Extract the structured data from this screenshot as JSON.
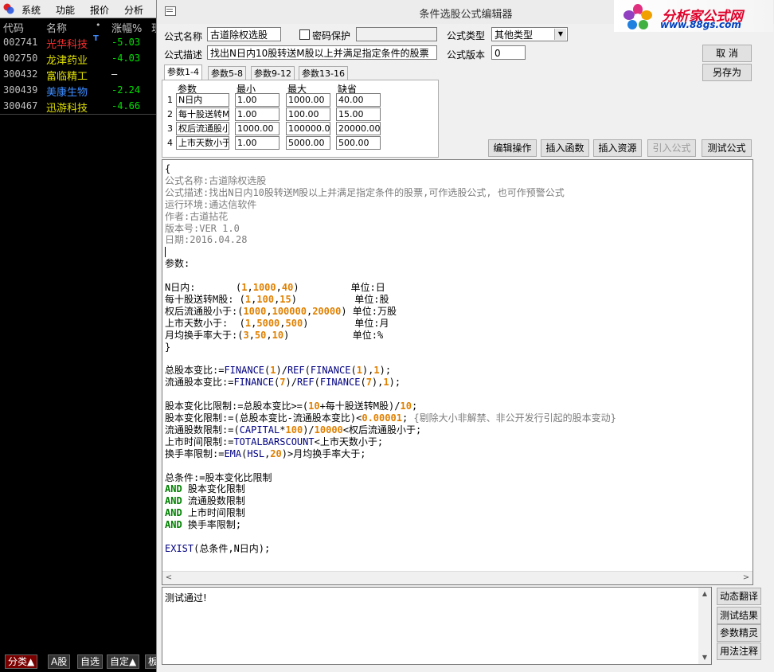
{
  "left_panel": {
    "menu": [
      "系统",
      "功能",
      "报价",
      "分析"
    ],
    "headers": {
      "code": "代码",
      "name": "名称",
      "dot": "•",
      "change": "涨幅%",
      "extra": "现"
    },
    "rows": [
      {
        "code": "002741",
        "name": "光华科技",
        "badge": "T",
        "change": "-5.03",
        "name_color": "#FF3030",
        "change_color": "#00E000"
      },
      {
        "code": "002750",
        "name": "龙津药业",
        "badge": "",
        "change": "-4.03",
        "name_color": "#E0E000",
        "change_color": "#00E000"
      },
      {
        "code": "300432",
        "name": "富临精工",
        "badge": "",
        "change": "—",
        "name_color": "#E0E000",
        "change_color": "#FFFFFF"
      },
      {
        "code": "300439",
        "name": "美康生物",
        "badge": "",
        "change": "-2.24",
        "name_color": "#3C8CFF",
        "change_color": "#00E000"
      },
      {
        "code": "300467",
        "name": "迅游科技",
        "badge": "",
        "change": "-4.66",
        "name_color": "#E0E000",
        "change_color": "#00E000"
      }
    ],
    "bottom_tabs": [
      "分类▲",
      "A股",
      "自选",
      "自定▲",
      "板"
    ]
  },
  "dialog": {
    "title": "条件选股公式编辑器",
    "watermark": {
      "line1": "分析家公式网",
      "line2": "www.88gs.com"
    },
    "labels": {
      "formula_name": "公式名称",
      "password": "密码保护",
      "formula_type": "公式类型",
      "formula_desc": "公式描述",
      "formula_version": "公式版本"
    },
    "formula_name": "古道除权选股",
    "password_value": "",
    "formula_type": "其他类型",
    "formula_desc": "找出N日内10股转送M股以上并满足指定条件的股票",
    "formula_version": "0",
    "buttons": {
      "cancel": "取  消",
      "save_as": "另存为",
      "edit_op": "编辑操作",
      "insert_func": "插入函数",
      "insert_res": "插入资源",
      "import_formula": "引入公式",
      "test_formula": "测试公式",
      "dyn_translate": "动态翻译",
      "test_result": "测试结果",
      "param_wizard": "参数精灵",
      "usage_notes": "用法注释"
    },
    "tabs": [
      "参数1-4",
      "参数5-8",
      "参数9-12",
      "参数13-16"
    ],
    "param_headers": {
      "param": "参数",
      "min": "最小",
      "max": "最大",
      "default": "缺省"
    },
    "params": [
      {
        "idx": "1",
        "name": "N日内",
        "min": "1.00",
        "max": "1000.00",
        "def": "40.00"
      },
      {
        "idx": "2",
        "name": "每十股送转M",
        "min": "1.00",
        "max": "100.00",
        "def": "15.00"
      },
      {
        "idx": "3",
        "name": "权后流通股小",
        "min": "1000.00",
        "max": "100000.00",
        "def": "20000.00"
      },
      {
        "idx": "4",
        "name": "上市天数小于",
        "min": "1.00",
        "max": "5000.00",
        "def": "500.00"
      }
    ],
    "code_lines": [
      "{",
      "公式名称:古道除权选股",
      "公式描述:找出N日内10股转送M股以上并满足指定条件的股票,可作选股公式, 也可作预警公式",
      "运行环境:通达信软件",
      "作者:古道拈花",
      "版本号:VER 1.0",
      "日期:2016.04.28",
      "",
      "参数:",
      "",
      "N日内:       (1,1000,40)         单位:日",
      "每十股送转M股: (1,100,15)          单位:股",
      "权后流通股小于:(1000,100000,20000) 单位:万股",
      "上市天数小于:  (1,5000,500)        单位:月",
      "月均换手率大于:(3,50,10)           单位:%",
      "}",
      "",
      "总股本变比:=FINANCE(1)/REF(FINANCE(1),1);",
      "流通股本变比:=FINANCE(7)/REF(FINANCE(7),1);",
      "",
      "股本变化比限制:=总股本变比>=(10+每十股送转M股)/10;",
      "股本变化限制:=(总股本变比-流通股本变比)<0.00001; {剔除大小非解禁、非公开发行引起的股本变动}",
      "流通股数限制:=(CAPITAL*100)/10000<权后流通股小于;",
      "上市时间限制:=TOTALBARSCOUNT<上市天数小于;",
      "换手率限制:=EMA(HSL,20)>月均换手率大于;",
      "",
      "总条件:=股本变化比限制",
      "AND 股本变化限制",
      "AND 流通股数限制",
      "AND 上市时间限制",
      "AND 换手率限制;",
      "",
      "EXIST(总条件,N日内);"
    ],
    "output_text": "测试通过!"
  },
  "colors": {
    "comment": "#7C7C7C",
    "keyword": "#008000",
    "number": "#E08000",
    "function": "#000080"
  }
}
